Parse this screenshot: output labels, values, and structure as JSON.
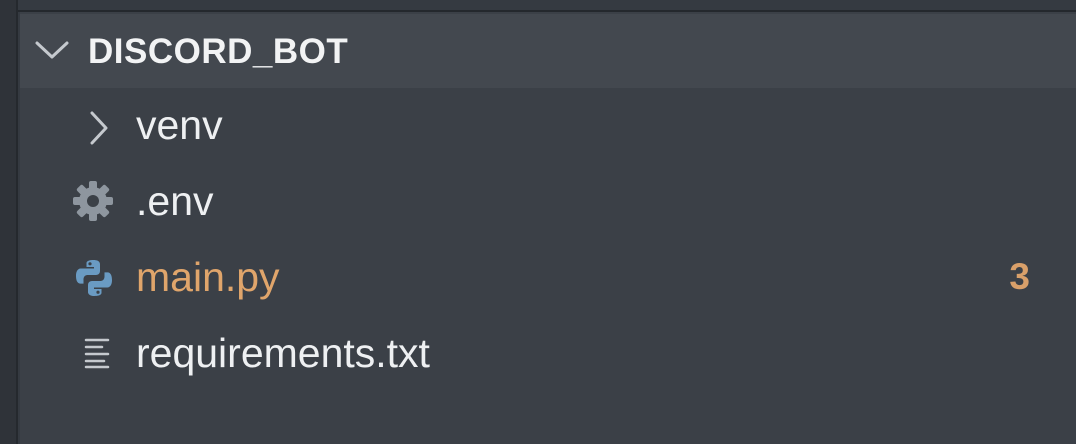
{
  "explorer": {
    "folder": {
      "name": "DISCORD_BOT",
      "expanded": true,
      "icon": "chevron-down-icon"
    },
    "items": [
      {
        "label": "venv",
        "icon": "chevron-right-icon",
        "type": "folder"
      },
      {
        "label": ".env",
        "icon": "gear-icon",
        "type": "file"
      },
      {
        "label": "main.py",
        "icon": "python-icon",
        "type": "file",
        "badge": "3",
        "status_color": "#e0a56b"
      },
      {
        "label": "requirements.txt",
        "icon": "text-lines-icon",
        "type": "file"
      }
    ]
  },
  "colors": {
    "background": "#3b4047",
    "header": "#43484f",
    "text": "#eef0f2",
    "modified": "#e0a56b"
  }
}
